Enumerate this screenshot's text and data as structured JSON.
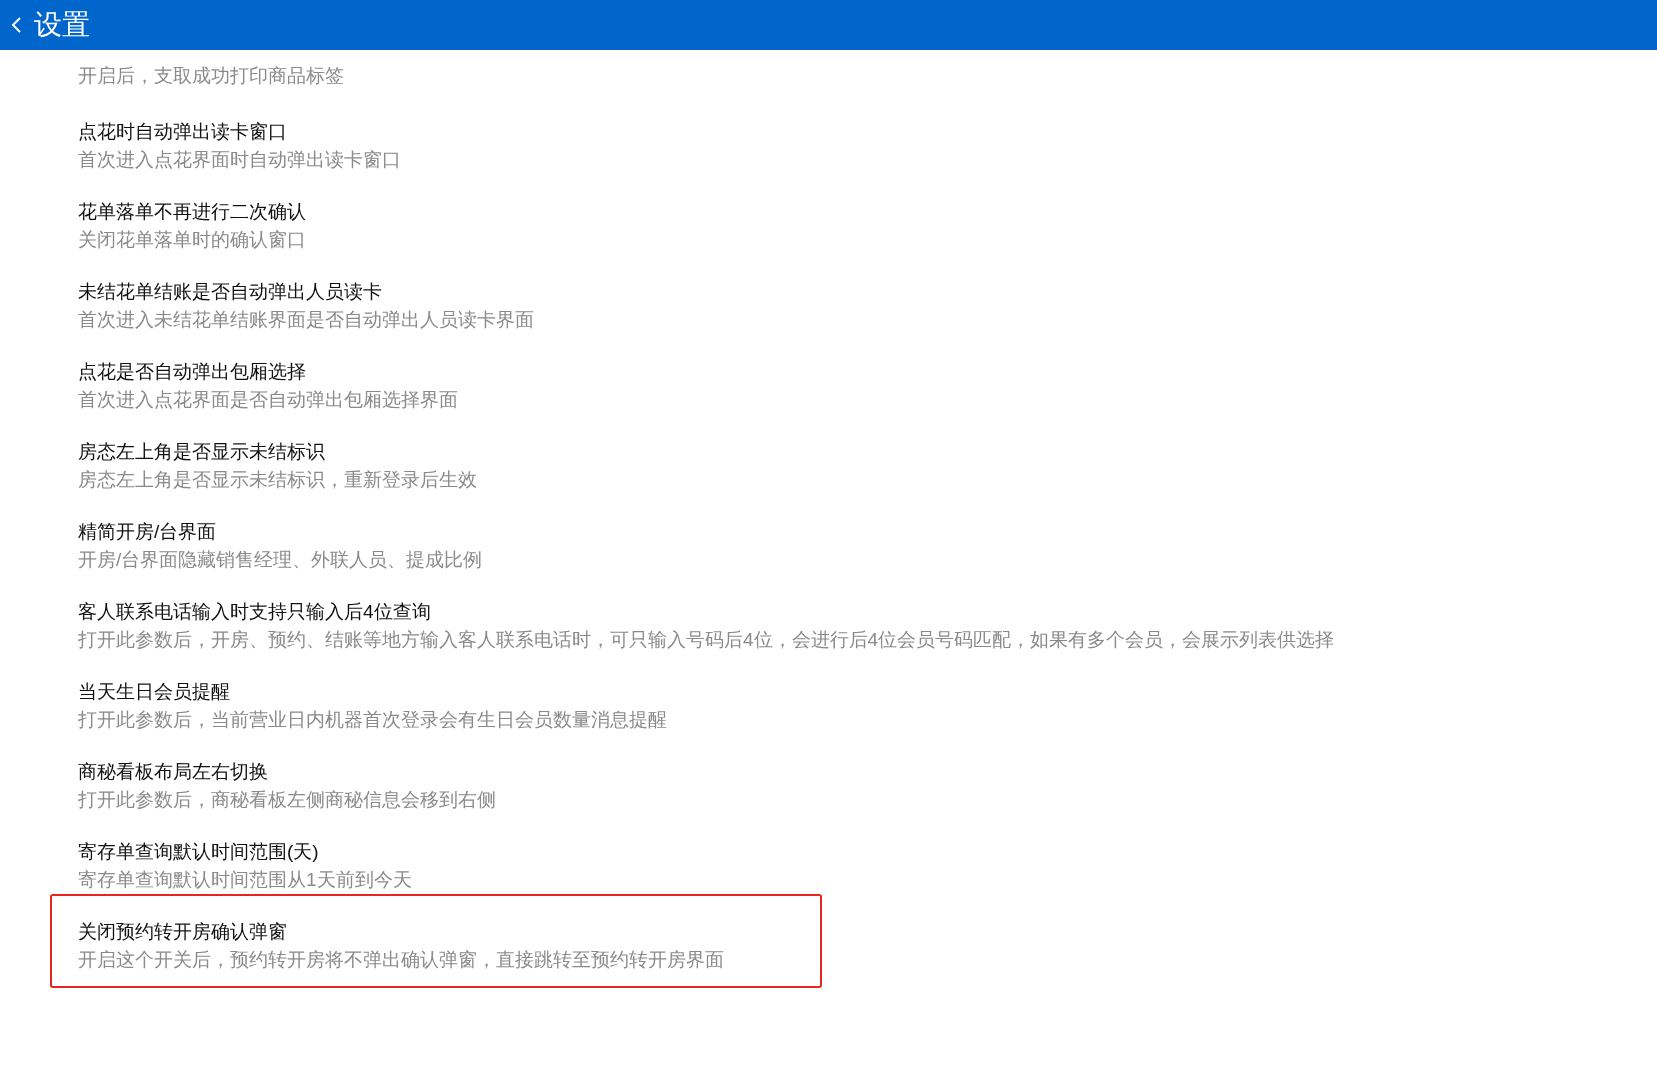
{
  "header": {
    "title": "设置"
  },
  "settings": [
    {
      "description": "开启后，支取成功打印商品标签",
      "highlighted": false
    },
    {
      "title": "点花时自动弹出读卡窗口",
      "description": "首次进入点花界面时自动弹出读卡窗口",
      "highlighted": false
    },
    {
      "title": "花单落单不再进行二次确认",
      "description": "关闭花单落单时的确认窗口",
      "highlighted": false
    },
    {
      "title": "未结花单结账是否自动弹出人员读卡",
      "description": "首次进入未结花单结账界面是否自动弹出人员读卡界面",
      "highlighted": false
    },
    {
      "title": "点花是否自动弹出包厢选择",
      "description": "首次进入点花界面是否自动弹出包厢选择界面",
      "highlighted": false
    },
    {
      "title": "房态左上角是否显示未结标识",
      "description": "房态左上角是否显示未结标识，重新登录后生效",
      "highlighted": false
    },
    {
      "title": "精简开房/台界面",
      "description": "开房/台界面隐藏销售经理、外联人员、提成比例",
      "highlighted": false
    },
    {
      "title": "客人联系电话输入时支持只输入后4位查询",
      "description": "打开此参数后，开房、预约、结账等地方输入客人联系电话时，可只输入号码后4位，会进行后4位会员号码匹配，如果有多个会员，会展示列表供选择",
      "highlighted": false
    },
    {
      "title": "当天生日会员提醒",
      "description": "打开此参数后，当前营业日内机器首次登录会有生日会员数量消息提醒",
      "highlighted": false
    },
    {
      "title": "商秘看板布局左右切换",
      "description": "打开此参数后，商秘看板左侧商秘信息会移到右侧",
      "highlighted": false
    },
    {
      "title": "寄存单查询默认时间范围(天)",
      "description": "寄存单查询默认时间范围从1天前到今天",
      "highlighted": false
    },
    {
      "title": "关闭预约转开房确认弹窗",
      "description": "开启这个开关后，预约转开房将不弹出确认弹窗，直接跳转至预约转开房界面",
      "highlighted": true
    }
  ]
}
